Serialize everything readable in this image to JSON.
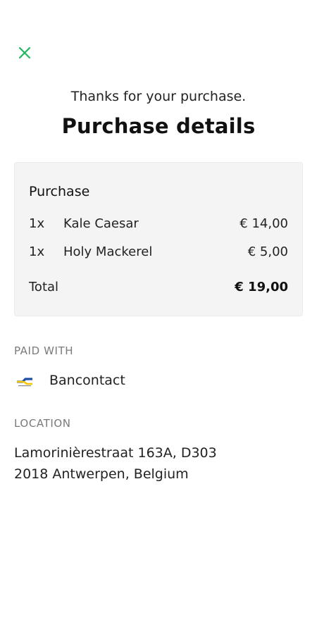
{
  "header": {
    "close_icon": "close-icon",
    "subtitle": "Thanks for your purchase.",
    "title": "Purchase details"
  },
  "purchase": {
    "title": "Purchase",
    "items": [
      {
        "qty": "1x",
        "name": "Kale Caesar",
        "price": "€ 14,00"
      },
      {
        "qty": "1x",
        "name": "Holy Mackerel",
        "price": "€ 5,00"
      }
    ],
    "total_label": "Total",
    "total_value": "€ 19,00"
  },
  "payment": {
    "label": "PAID WITH",
    "method": "Bancontact",
    "icon": "bancontact-logo-icon"
  },
  "location": {
    "label": "LOCATION",
    "address_line1": "Lamorinièrestraat 163A, D303",
    "address_line2": "2018 Antwerpen, Belgium"
  },
  "colors": {
    "accent": "#1fb85f",
    "card_background": "#f4f4f4",
    "muted_text": "#7a7a7a"
  }
}
